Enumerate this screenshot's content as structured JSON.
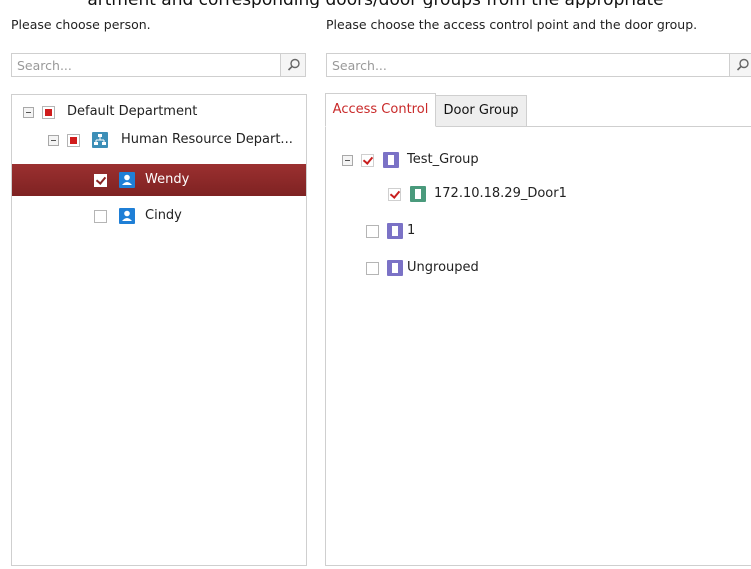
{
  "banner_text": "artment and corresponding doors/door groups from the appropriate",
  "left_pane": {
    "label": "Please choose person.",
    "search_placeholder": "Search...",
    "tree": [
      {
        "label": "Default Department",
        "level": 0,
        "expander": true,
        "check": "partial",
        "icon": "none"
      },
      {
        "label": "Human Resource Depart...",
        "level": 1,
        "expander": true,
        "check": "partial",
        "icon": "organization-icon"
      },
      {
        "label": "Wendy",
        "level": 2,
        "expander": false,
        "check": "checked",
        "icon": "person-icon",
        "selected": true
      },
      {
        "label": "Cindy",
        "level": 2,
        "expander": false,
        "check": "unchecked",
        "icon": "person-icon"
      }
    ]
  },
  "right_pane": {
    "label": "Please choose the access control point and the door group.",
    "search_placeholder": "Search...",
    "tabs": [
      {
        "label": "Access Control",
        "active": true
      },
      {
        "label": "Door Group",
        "active": false
      }
    ],
    "tree": [
      {
        "label": "Test_Group",
        "level": 0,
        "expander": true,
        "check": "checked",
        "icon": "door-group-icon"
      },
      {
        "label": "172.10.18.29_Door1",
        "level": 1,
        "expander": false,
        "check": "checked",
        "icon": "door-icon"
      },
      {
        "label": "1",
        "level": 0,
        "expander": false,
        "check": "unchecked",
        "icon": "door-group-icon"
      },
      {
        "label": "Ungrouped",
        "level": 0,
        "expander": false,
        "check": "unchecked",
        "icon": "door-group-icon"
      }
    ]
  },
  "colors": {
    "selection": "#8b2727",
    "accent_red": "#c92a2a",
    "group_icon": "#7b72c6",
    "door_icon": "#4a9a7c",
    "person_icon": "#1f7fd6",
    "org_icon": "#3d8fb7"
  }
}
